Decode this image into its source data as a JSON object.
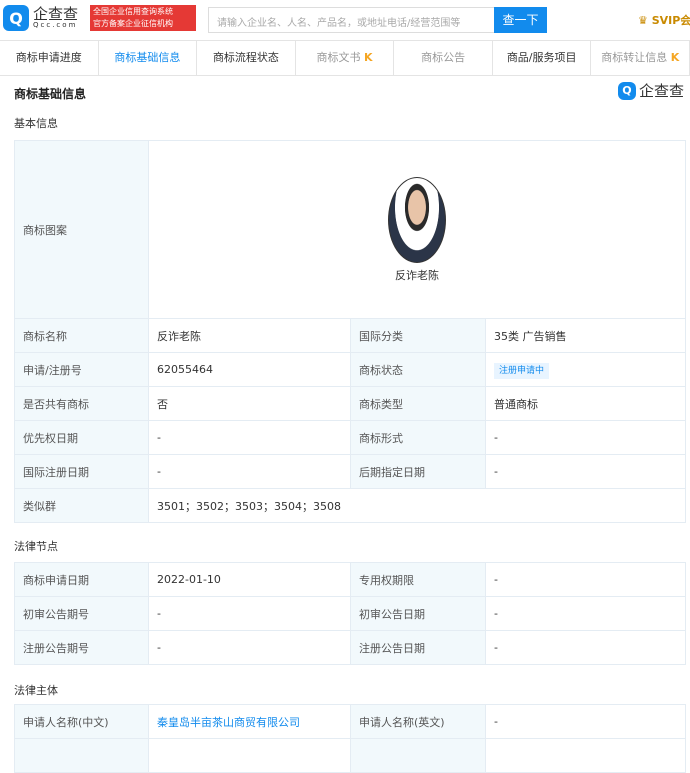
{
  "header": {
    "logo_mark": "Q",
    "logo_text": "企查查",
    "logo_domain": "Qcc.com",
    "badge_line1": "全国企业信用查询系统",
    "badge_line2": "官方备案企业征信机构",
    "search_placeholder": "请输入企业名、人名、产品名，或地址电话/经营范围等",
    "search_button": "查一下",
    "vip": "SVIP会"
  },
  "tabs": [
    {
      "label": "商标申请进度"
    },
    {
      "label": "商标基础信息"
    },
    {
      "label": "商标流程状态"
    },
    {
      "label": "商标文书"
    },
    {
      "label": "商标公告"
    },
    {
      "label": "商品/服务项目"
    },
    {
      "label": "商标转让信息"
    }
  ],
  "section_title": "商标基础信息",
  "watermark": "企查查",
  "basic": {
    "title": "基本信息",
    "image_label": "商标图案",
    "image_caption": "反诈老陈",
    "rows": [
      [
        "商标名称",
        "反诈老陈",
        "国际分类",
        "35类 广告销售"
      ],
      [
        "申请/注册号",
        "62055464",
        "商标状态",
        "注册申请中"
      ],
      [
        "是否共有商标",
        "否",
        "商标类型",
        "普通商标"
      ],
      [
        "优先权日期",
        "-",
        "商标形式",
        "-"
      ],
      [
        "国际注册日期",
        "-",
        "后期指定日期",
        "-"
      ]
    ],
    "similar_label": "类似群",
    "similar_value": "3501；3502；3503；3504；3508"
  },
  "legal_nodes": {
    "title": "法律节点",
    "rows": [
      [
        "商标申请日期",
        "2022-01-10",
        "专用权期限",
        "-"
      ],
      [
        "初审公告期号",
        "-",
        "初审公告日期",
        "-"
      ],
      [
        "注册公告期号",
        "-",
        "注册公告日期",
        "-"
      ]
    ]
  },
  "legal_entity": {
    "title": "法律主体",
    "rows": [
      [
        "申请人名称(中文)",
        "秦皇岛半亩茶山商贸有限公司",
        "申请人名称(英文)",
        "-"
      ]
    ]
  }
}
